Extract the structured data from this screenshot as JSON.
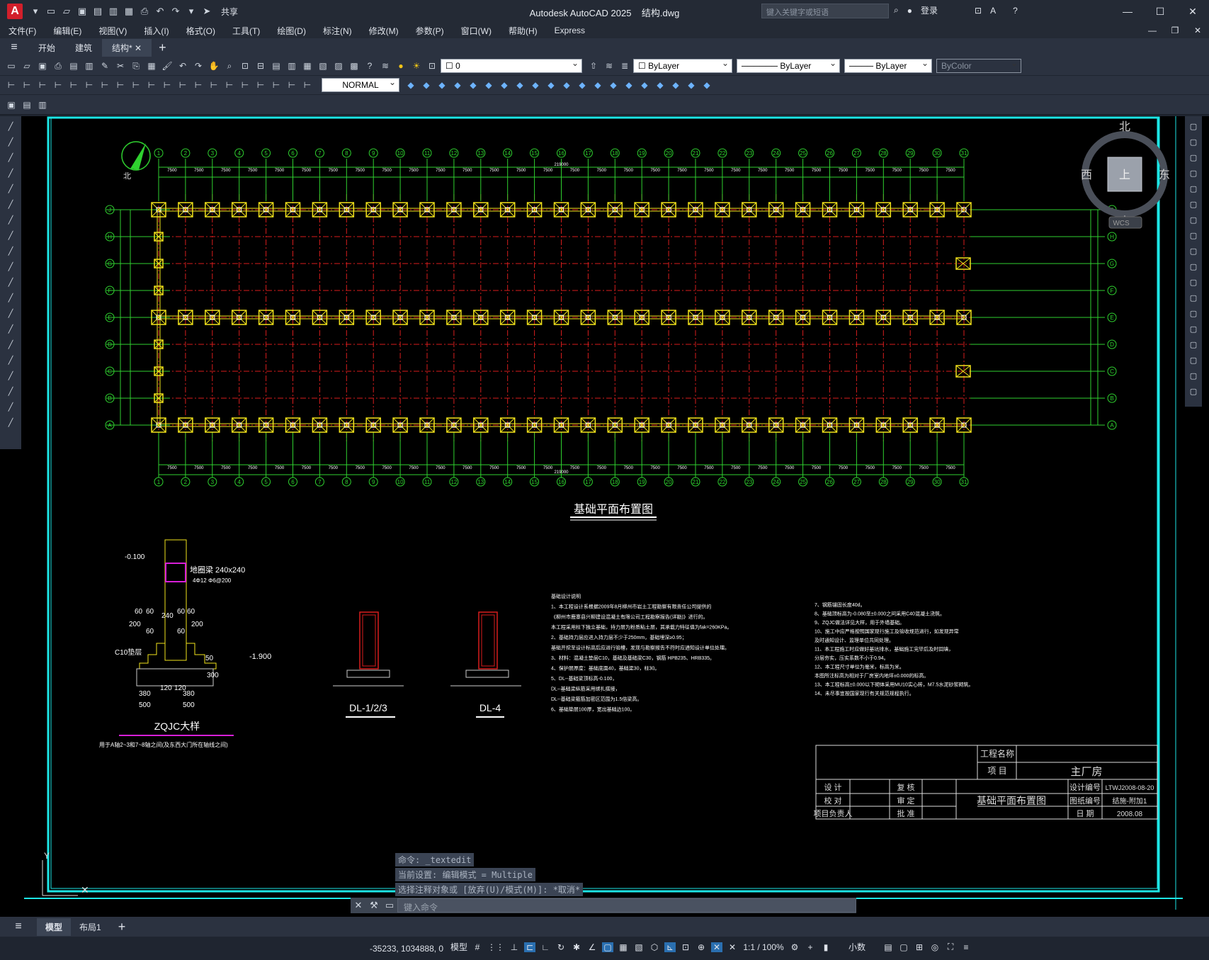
{
  "app": {
    "title": "Autodesk AutoCAD 2025",
    "file": "结构.dwg",
    "logo": "A"
  },
  "quick_access": {
    "share_label": "共享"
  },
  "search": {
    "placeholder": "键入关键字或短语"
  },
  "account": {
    "login_label": "登录"
  },
  "menu": [
    "文件(F)",
    "编辑(E)",
    "视图(V)",
    "插入(I)",
    "格式(O)",
    "工具(T)",
    "绘图(D)",
    "标注(N)",
    "修改(M)",
    "参数(P)",
    "窗口(W)",
    "帮助(H)",
    "Express"
  ],
  "file_tabs": [
    "开始",
    "建筑",
    "结构*"
  ],
  "toolbar": {
    "dimstyle": "NORMAL",
    "layer": "0",
    "color": "ByLayer",
    "linetype": "ByLayer",
    "lineweight": "ByLayer",
    "plotstyle": "ByColor"
  },
  "viewcube": {
    "north": "北",
    "south": "南",
    "east": "东",
    "west": "西",
    "top": "上",
    "wcs": "WCS"
  },
  "drawing": {
    "plan_title": "基础平面布置图",
    "total_dim": "219000",
    "bay_dim": "7500",
    "column_labels": [
      "1",
      "2",
      "3",
      "4",
      "5",
      "6",
      "7",
      "8",
      "9",
      "10",
      "11",
      "12",
      "13",
      "14",
      "15",
      "16",
      "17",
      "18",
      "19",
      "20",
      "21",
      "22",
      "23",
      "24",
      "25",
      "26",
      "27",
      "28",
      "29",
      "30",
      "31"
    ],
    "row_labels": [
      "J",
      "H",
      "G",
      "F",
      "E",
      "D",
      "C",
      "B",
      "A"
    ],
    "north_label": "北",
    "detail_zqjc": {
      "title": "ZQJC大样",
      "note": "用于A轴2~3和7~8轴之间(及东西大门所在轴线之间)",
      "beam": "地圈梁 240x240",
      "rebar": "4Φ12    Φ6@200",
      "elev_top": "-0.100",
      "elev_bot": "-1.900",
      "pad": "C10垫层",
      "dims": [
        "60",
        "60",
        "240",
        "60",
        "60",
        "200",
        "200",
        "60",
        "60",
        "380",
        "120",
        "120",
        "380",
        "500",
        "500",
        "300",
        "50"
      ]
    },
    "detail_dl123": {
      "title": "DL-1/2/3"
    },
    "detail_dl4": {
      "title": "DL-4"
    },
    "notes_left": [
      "基础设计说明",
      "1、本工程设计系根据2009年8月柳州市岩土工程勘察有限责任公司提供的",
      "《柳州市鹿寨县兴柳建设混凝土有限公司工程勘察报告(详勘)》进行的。",
      "本工程采用柱下独立基础，持力层为粉质粘土层，其承载力特征值为fak=260KPa。",
      "2、基础持力层应进入持力层不少于250mm，基础埋深≥0.95；",
      "基础开挖至设计标高后应进行验槽，发现与勘察报告不符时应通知设计单位处理。",
      "3、材料：混凝土垫层C10，基础及基础梁C30，钢筋 HPB235、HRB335。",
      "4、保护层厚度：基础底面40，基础梁30，柱30。",
      "5、DL--基础梁顶标高-0.100，",
      "DL--基础梁纵筋采用绑扎搭接，",
      "DL--基础梁箍筋加密区范围为1.5倍梁高。",
      "6、基础垫层100厚，宽出基础边100。"
    ],
    "notes_right": [
      "7、钢筋锚固长度40d。",
      "8、基础顶标高为-0.080至±0.000之间采用C40混凝土浇筑。",
      "9、ZQJC做法详见大样，用于外墙基础。",
      "10、施工中应严格按照国家现行施工及验收规范进行，如发现异常",
      "及时通知设计、监理单位共同处理。",
      "11、本工程施工时应做好基坑排水，基础施工完毕后及时回填，",
      "分层夯实，压实系数不小于0.94。",
      "12、本工程尺寸单位为毫米，标高为米。",
      "本图所注标高为相对于厂房室内地坪±0.000的标高。",
      "13、本工程标高±0.000以下砌体采用MU10实心砖，M7.5水泥砂浆砌筑。",
      "14、未尽事宜按国家现行有关规范规程执行。"
    ],
    "title_block": {
      "project_label": "工程名称",
      "item_label": "项 目",
      "item_value": "主厂房",
      "drawing_name": "基础平面布置图",
      "design": "设 计",
      "check": "校 对",
      "lead": "项目负责人",
      "review": "复 核",
      "audit": "审 定",
      "approve": "批 准",
      "design_no_label": "设计编号",
      "design_no": "LTWJ2008-08-20",
      "drawing_no_label": "图纸编号",
      "drawing_no": "结施-附加1",
      "date_label": "日 期",
      "date": "2008.08"
    }
  },
  "command": {
    "history": [
      "命令: _textedit",
      "当前设置: 编辑模式 = Multiple",
      "选择注释对象或 [放弃(U)/模式(M)]: *取消*"
    ],
    "placeholder": "键入命令"
  },
  "layout_tabs": [
    "模型",
    "布局1"
  ],
  "status": {
    "coords": "-35233, 1034888, 0",
    "model": "模型",
    "scale": "1:1 / 100%",
    "units": "小数"
  },
  "colors": {
    "bg": "#000000",
    "grid_red": "#d81d1d",
    "dim_green": "#2fd12f",
    "footing_yellow": "#f2e31b",
    "border_cyan": "#1de6e6",
    "magenta": "#d81fd8"
  }
}
